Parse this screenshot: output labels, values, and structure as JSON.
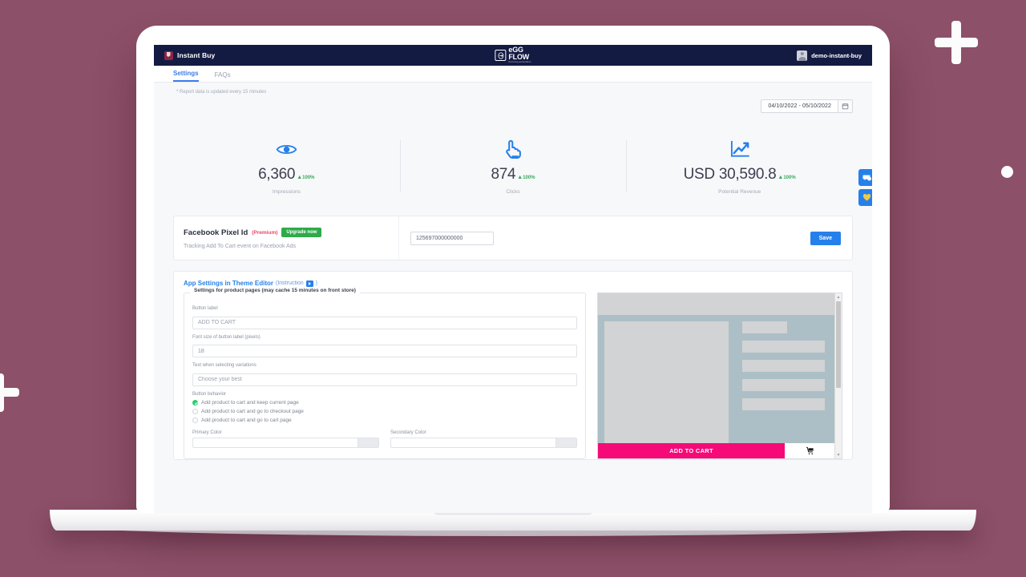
{
  "decor": {
    "background_color": "#8c5068",
    "accent_white": "#fdfcfc"
  },
  "topbar": {
    "brand_name": "Instant Buy",
    "logo": {
      "line1": "eGG",
      "line2": "FLOW",
      "tagline": "Nurturing automation"
    },
    "account_name": "demo-instant-buy"
  },
  "tabs": [
    {
      "label": "Settings",
      "active": true
    },
    {
      "label": "FAQs",
      "active": false
    }
  ],
  "note": "* Report data is updated every 15 minutes",
  "datepicker": {
    "value": "04/10/2022 - 05/10/2022",
    "icon": "calendar-icon"
  },
  "stats": [
    {
      "icon": "eye-icon",
      "value": "6,360",
      "delta": "100%",
      "label": "Impressions"
    },
    {
      "icon": "click-icon",
      "value": "874",
      "delta": "100%",
      "label": "Clicks"
    },
    {
      "icon": "trend-icon",
      "value": "USD 30,590.8",
      "delta": "100%",
      "label": "Potential Revenue"
    }
  ],
  "pixel": {
    "title": "Facebook Pixel Id",
    "premium_tag": "(Premium)",
    "upgrade_label": "Upgrade now",
    "subtitle": "Tracking Add To Cart event on Facebook Ads",
    "input_value": "125697000000000",
    "save_label": "Save"
  },
  "settings": {
    "title": "App Settings in Theme Editor",
    "instruction_prefix": "(Instruction",
    "instruction_suffix": ")",
    "legend": "Settings for product pages (may cache 15 minutes on front store)",
    "fields": [
      {
        "label": "Button label",
        "value": "ADD TO CART"
      },
      {
        "label": "Font size of button label (pixels)",
        "value": "18"
      },
      {
        "label": "Text when selecting variations",
        "value": "Choose your best"
      }
    ],
    "behavior_label": "Button behavior",
    "behavior_options": [
      {
        "label": "Add product to cart and keep current page",
        "checked": true
      },
      {
        "label": "Add product to cart and go to checkout page",
        "checked": false
      },
      {
        "label": "Add product to cart and go to cart page",
        "checked": false
      }
    ],
    "colors": [
      {
        "label": "Primary Color"
      },
      {
        "label": "Secondary Color"
      }
    ]
  },
  "preview": {
    "cta_label": "ADD TO CART",
    "cta_color": "#f50a78",
    "cart_icon": "shopping-cart-icon"
  },
  "floaters": [
    {
      "icon": "chat-bubble-icon",
      "color": "#2680eb"
    },
    {
      "icon": "heart-icon",
      "color": "#2680eb"
    }
  ]
}
